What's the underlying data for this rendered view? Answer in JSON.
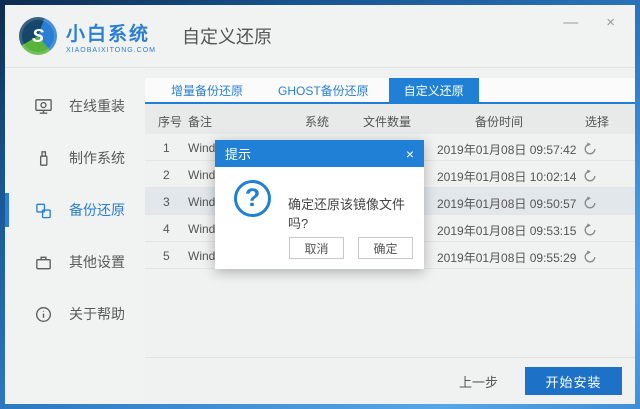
{
  "window": {
    "brand": {
      "name": "小白系统",
      "domain": "XIAOBAIXITONG.COM",
      "logo_letter": "S"
    },
    "page_title": "自定义还原",
    "controls": {
      "minimize": "—",
      "close": "×"
    }
  },
  "sidebar": {
    "items": [
      {
        "label": "在线重装",
        "icon": "monitor-icon",
        "active": false
      },
      {
        "label": "制作系统",
        "icon": "usb-icon",
        "active": false
      },
      {
        "label": "备份还原",
        "icon": "backup-restore-icon",
        "active": true
      },
      {
        "label": "其他设置",
        "icon": "briefcase-icon",
        "active": false
      },
      {
        "label": "关于帮助",
        "icon": "info-icon",
        "active": false
      }
    ]
  },
  "tabs": [
    {
      "label": "增量备份还原",
      "active": false
    },
    {
      "label": "GHOST备份还原",
      "active": false
    },
    {
      "label": "自定义还原",
      "active": true
    }
  ],
  "table": {
    "headers": [
      "序号",
      "备注",
      "系统",
      "文件数量",
      "备份时间",
      "选择"
    ],
    "rows": [
      {
        "no": "1",
        "remark": "Wind",
        "time": "2019年01月08日 09:57:42",
        "selected": false
      },
      {
        "no": "2",
        "remark": "Wind",
        "time": "2019年01月08日 10:02:14",
        "selected": false
      },
      {
        "no": "3",
        "remark": "Wind",
        "time": "2019年01月08日 09:50:57",
        "selected": true
      },
      {
        "no": "4",
        "remark": "Wind",
        "time": "2019年01月08日 09:53:15",
        "selected": false
      },
      {
        "no": "5",
        "remark": "Wind",
        "time": "2019年01月08日 09:55:29",
        "selected": false
      }
    ]
  },
  "dialog": {
    "title": "提示",
    "close": "×",
    "icon_glyph": "?",
    "message": "确定还原该镜像文件吗?",
    "buttons": {
      "cancel": "取消",
      "confirm": "确定"
    }
  },
  "footer": {
    "back": "上一步",
    "start": "开始安装"
  },
  "colors": {
    "accent": "#2080d5",
    "link": "#2a7fd4",
    "start_button": "#1d72c8"
  }
}
